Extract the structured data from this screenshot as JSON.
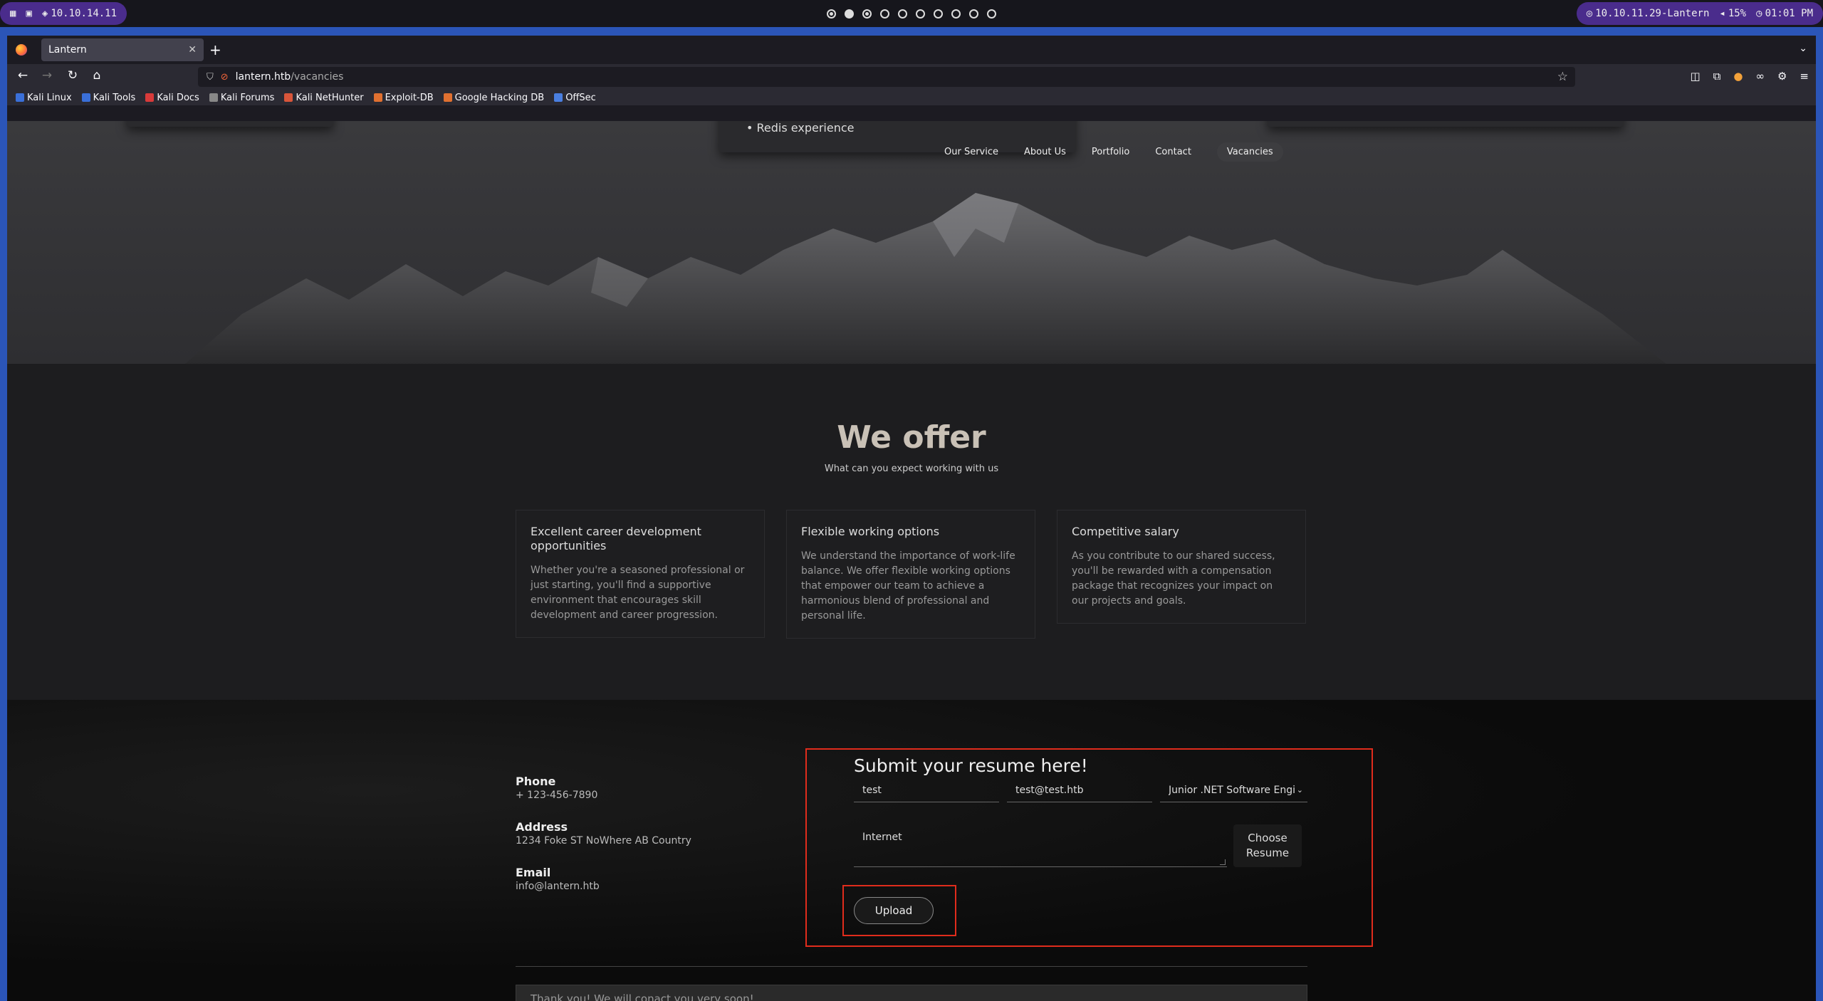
{
  "desktop": {
    "ip_left": "10.10.14.11",
    "target": "10.10.11.29-Lantern",
    "volume": "15%",
    "clock": "01:01 PM",
    "workspaces": [
      false,
      true,
      false,
      false,
      false,
      false,
      false,
      false,
      false,
      false
    ]
  },
  "browser": {
    "tab_title": "Lantern",
    "url_host": "lantern.htb",
    "url_path": "/vacancies",
    "bookmarks": [
      "Kali Linux",
      "Kali Tools",
      "Kali Docs",
      "Kali Forums",
      "Kali NetHunter",
      "Exploit-DB",
      "Google Hacking DB",
      "OffSec"
    ]
  },
  "hero": {
    "requirement_item": "Redis experience",
    "nav": [
      "Our Service",
      "About Us",
      "Portfolio",
      "Contact",
      "Vacancies"
    ]
  },
  "offer": {
    "title": "We offer",
    "subtitle": "What can you expect working with us",
    "cards": [
      {
        "title": "Excellent career development opportunities",
        "text": "Whether you're a seasoned professional or just starting, you'll find a supportive environment that encourages skill development and career progression."
      },
      {
        "title": "Flexible working options",
        "text": "We understand the importance of work-life balance. We offer flexible working options that empower our team to achieve a harmonious blend of professional and personal life."
      },
      {
        "title": "Competitive salary",
        "text": "As you contribute to our shared success, you'll be rewarded with a compensation package that recognizes your impact on our projects and goals."
      }
    ]
  },
  "contact": {
    "phone_label": "Phone",
    "phone": "+ 123-456-7890",
    "address_label": "Address",
    "address": "1234 Foke ST NoWhere AB Country",
    "email_label": "Email",
    "email": "info@lantern.htb"
  },
  "form": {
    "title": "Submit your resume here!",
    "name_value": "test",
    "email_value": "test@test.htb",
    "vacancy_value": "Junior .NET Software Engi",
    "message_value": "Internet",
    "choose_label": "Choose Resume",
    "upload_label": "Upload",
    "toast": "Thank you! We will conact you very soon!"
  },
  "colors": {
    "highlight": "#e02c1c",
    "accent_title": "#c9c1b6"
  }
}
